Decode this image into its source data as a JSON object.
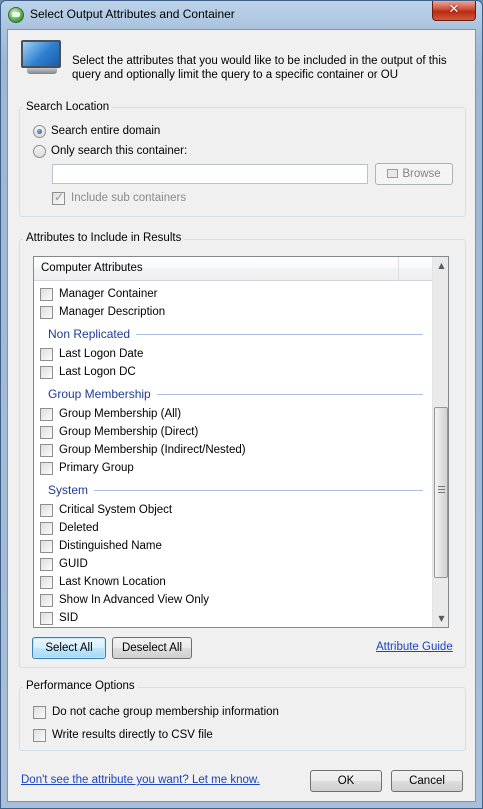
{
  "window": {
    "title": "Select Output Attributes and Container",
    "close_glyph": "✕"
  },
  "intro": {
    "text": "Select the attributes that you would like to be included in the output of this query and optionally limit the query to a specific container or OU"
  },
  "search_location": {
    "label": "Search Location",
    "entire_domain_label": "Search entire domain",
    "entire_domain_selected": true,
    "this_container_label": "Only search this container:",
    "container_value": "",
    "browse_label": "Browse",
    "include_sub_label": "Include sub containers",
    "include_sub_checked": true
  },
  "attributes": {
    "label": "Attributes to Include in Results",
    "column_header": "Computer Attributes",
    "items_a": [
      "Manager Container",
      "Manager Description"
    ],
    "group_non_replicated": "Non Replicated",
    "items_b": [
      "Last Logon Date",
      "Last Logon DC"
    ],
    "group_membership": "Group Membership",
    "items_c": [
      "Group Membership (All)",
      "Group Membership (Direct)",
      "Group Membership (Indirect/Nested)",
      "Primary Group"
    ],
    "group_system": "System",
    "items_d": [
      "Critical System Object",
      "Deleted",
      "Distinguished Name",
      "GUID",
      "Last Known Location",
      "Show In Advanced View Only",
      "SID"
    ],
    "select_all_label": "Select All",
    "deselect_all_label": "Deselect All",
    "guide_link": "Attribute Guide"
  },
  "performance": {
    "label": "Performance Options",
    "no_cache_label": "Do not cache group membership information",
    "csv_label": "Write results directly to CSV file"
  },
  "footer": {
    "feedback_link": "Don't see the attribute you want? Let me know.",
    "ok_label": "OK",
    "cancel_label": "Cancel"
  },
  "icons": {
    "app": "app-globe-icon",
    "monitor": "monitor-icon",
    "browse": "folder-icon",
    "scroll_up": "scroll-up-arrow-icon",
    "scroll_down": "scroll-down-arrow-icon"
  }
}
